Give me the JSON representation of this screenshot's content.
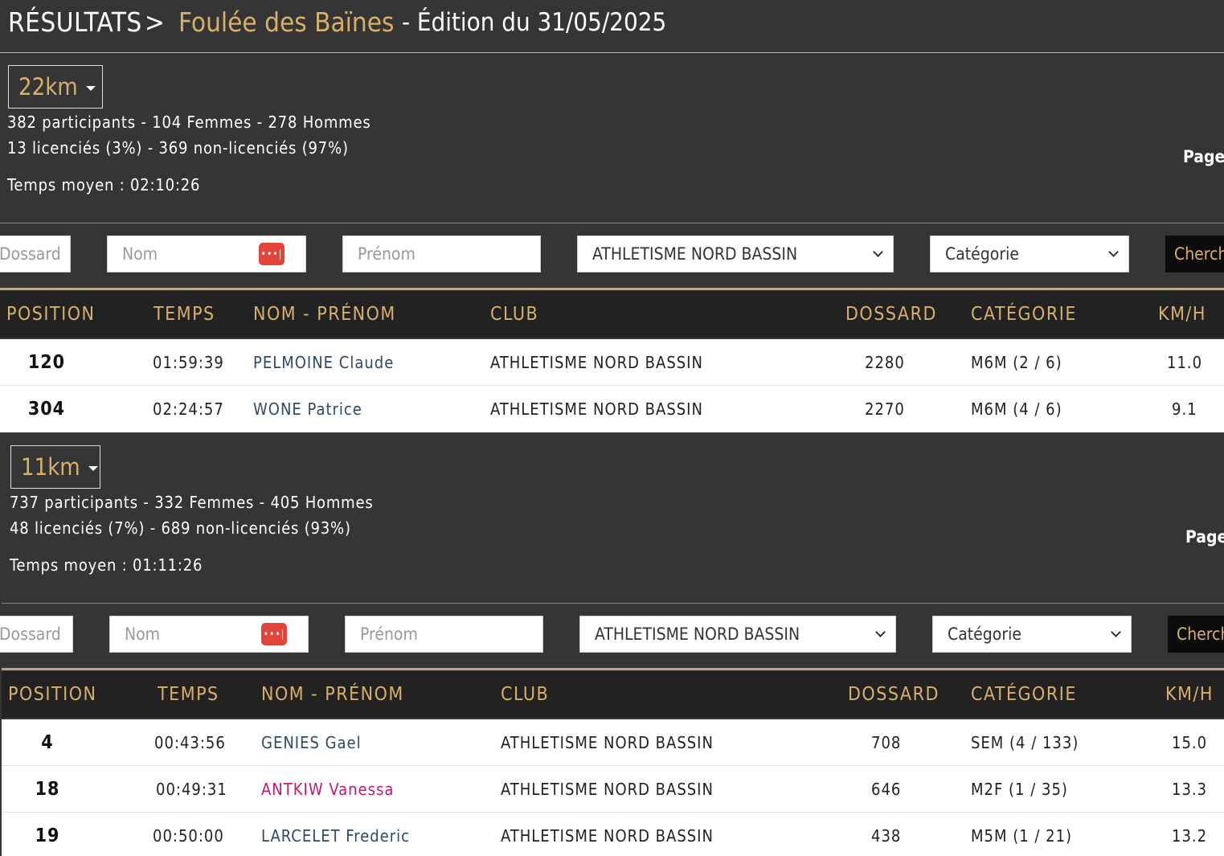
{
  "header": {
    "root": "RÉSULTATS",
    "separator": ">",
    "event_name": "Foulée des Baïnes",
    "edition": "- Édition du 31/05/2025"
  },
  "races": [
    {
      "distance": "22km",
      "participants": "382 participants - 104 Femmes - 278 Hommes",
      "licences": "13 licenciés (3%) - 369 non-licenciés (97%)",
      "avg_time": "Temps moyen : 02:10:26",
      "page_label": "Page",
      "filters": {
        "dossard_placeholder": "Dossard",
        "nom_placeholder": "Nom",
        "prenom_placeholder": "Prénom",
        "club_selected": "ATHLETISME NORD BASSIN",
        "categorie_selected": "Catégorie",
        "search_label": "Chercher"
      },
      "columns": [
        "POSITION",
        "TEMPS",
        "NOM - PRÉNOM",
        "CLUB",
        "DOSSARD",
        "CATÉGORIE",
        "KM/H"
      ],
      "rows": [
        {
          "position": "120",
          "temps": "01:59:39",
          "nom": "PELMOINE Claude",
          "club": "ATHLETISME NORD BASSIN",
          "dossard": "2280",
          "categorie": "M6M (2 / 6)",
          "kmh": "11.0",
          "female": false
        },
        {
          "position": "304",
          "temps": "02:24:57",
          "nom": "WONE Patrice",
          "club": "ATHLETISME NORD BASSIN",
          "dossard": "2270",
          "categorie": "M6M (4 / 6)",
          "kmh": "9.1",
          "female": false
        }
      ]
    },
    {
      "distance": "11km",
      "participants": "737 participants - 332 Femmes - 405 Hommes",
      "licences": "48 licenciés (7%) - 689 non-licenciés (93%)",
      "avg_time": "Temps moyen : 01:11:26",
      "page_label": "Page",
      "filters": {
        "dossard_placeholder": "Dossard",
        "nom_placeholder": "Nom",
        "prenom_placeholder": "Prénom",
        "club_selected": "ATHLETISME NORD BASSIN",
        "categorie_selected": "Catégorie",
        "search_label": "Chercher"
      },
      "columns": [
        "POSITION",
        "TEMPS",
        "NOM - PRÉNOM",
        "CLUB",
        "DOSSARD",
        "CATÉGORIE",
        "KM/H"
      ],
      "rows": [
        {
          "position": "4",
          "temps": "00:43:56",
          "nom": "GENIES Gael",
          "club": "ATHLETISME NORD BASSIN",
          "dossard": "708",
          "categorie": "SEM (4 / 133)",
          "kmh": "15.0",
          "female": false
        },
        {
          "position": "18",
          "temps": "00:49:31",
          "nom": "ANTKIW Vanessa",
          "club": "ATHLETISME NORD BASSIN",
          "dossard": "646",
          "categorie": "M2F (1 / 35)",
          "kmh": "13.3",
          "female": true
        },
        {
          "position": "19",
          "temps": "00:50:00",
          "nom": "LARCELET Frederic",
          "club": "ATHLETISME NORD BASSIN",
          "dossard": "438",
          "categorie": "M5M (1 / 21)",
          "kmh": "13.2",
          "female": false
        }
      ]
    }
  ],
  "colors": {
    "accent_gold": "#d8b06a",
    "background": "#353535",
    "table_header": "#222222",
    "name_male": "#2d4a66",
    "name_female": "#c21878",
    "password_icon": "#e0443b"
  },
  "icons": {
    "password_manager": "password-dots-icon",
    "dropdown": "chevron-down-icon",
    "distance_caret": "caret-down-icon"
  }
}
